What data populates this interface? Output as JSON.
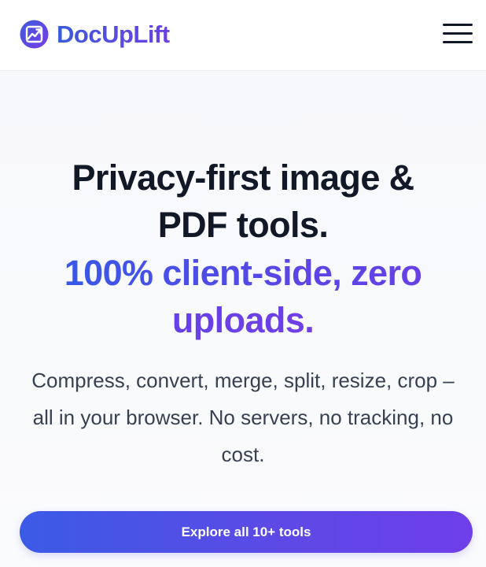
{
  "header": {
    "brand_name": "DocUpLift",
    "logo_icon": "chart-upload-icon",
    "menu_icon": "hamburger-menu-icon"
  },
  "hero": {
    "title_line1": "Privacy-first image &",
    "title_line2": "PDF tools.",
    "accent_line1": "100% client-side, zero",
    "accent_line2": "uploads.",
    "subtitle": "Compress, convert, merge, split, resize, crop – all in your browser. No servers, no tracking, no cost.",
    "cta_label": "Explore all 10+ tools"
  },
  "colors": {
    "brand_start": "#3b5bdb",
    "brand_end": "#6d3fe6",
    "title_text": "#111827",
    "body_text": "#374151",
    "background": "#f8f9fb"
  }
}
